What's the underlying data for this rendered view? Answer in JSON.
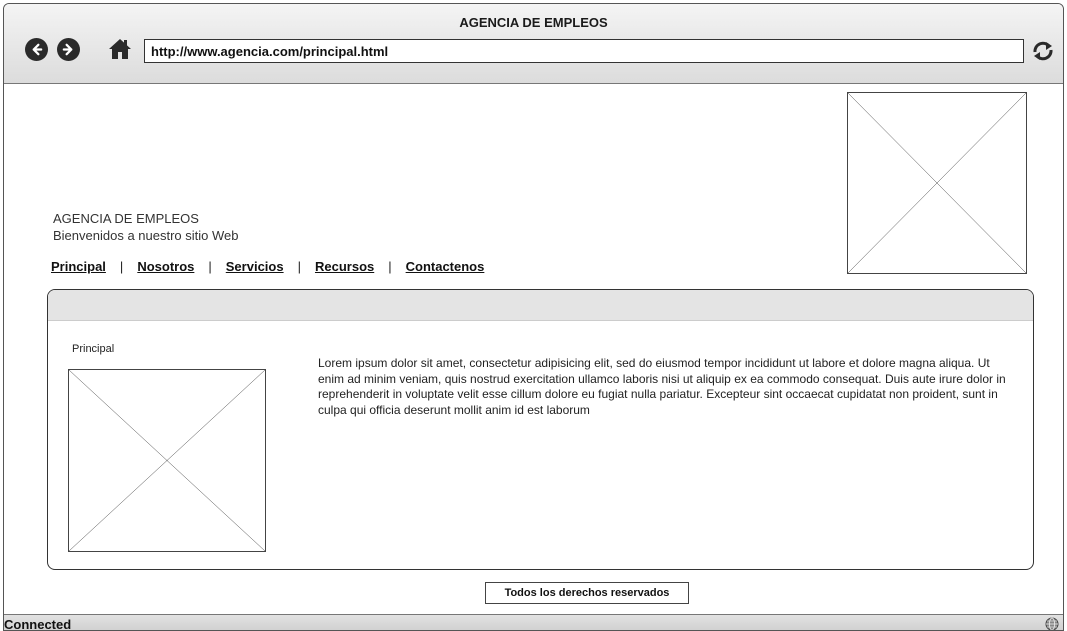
{
  "window": {
    "title": "AGENCIA DE EMPLEOS"
  },
  "toolbar": {
    "url": "http://www.agencia.com/principal.html",
    "back_icon": "arrow-left-circle-icon",
    "forward_icon": "arrow-right-circle-icon",
    "home_icon": "home-icon",
    "reload_icon": "reload-icon"
  },
  "header": {
    "brand_title": "AGENCIA DE EMPLEOS",
    "brand_subtitle": "Bienvenidos a nuestro sitio Web"
  },
  "menu": {
    "items": [
      "Principal",
      "Nosotros",
      "Servicios",
      "Recursos",
      "Contactenos"
    ],
    "separator": "|"
  },
  "panel": {
    "label": "Principal",
    "body": "Lorem ipsum dolor sit amet, consectetur adipisicing elit, sed do eiusmod tempor incididunt ut labore et dolore magna aliqua. Ut enim ad minim veniam, quis nostrud exercitation ullamco laboris nisi ut aliquip ex ea commodo consequat. Duis aute irure dolor in reprehenderit in voluptate velit esse cillum dolore eu fugiat nulla pariatur. Excepteur sint occaecat cupidatat non proident, sunt in culpa qui officia deserunt mollit anim id est laborum"
  },
  "footer": {
    "text": "Todos los derechos reservados"
  },
  "statusbar": {
    "text": "Connected",
    "icon": "globe-icon"
  },
  "colors": {
    "chrome": "#dcdcdc",
    "panel_header": "#e4e4e4",
    "icon": "#2a2a2a"
  }
}
